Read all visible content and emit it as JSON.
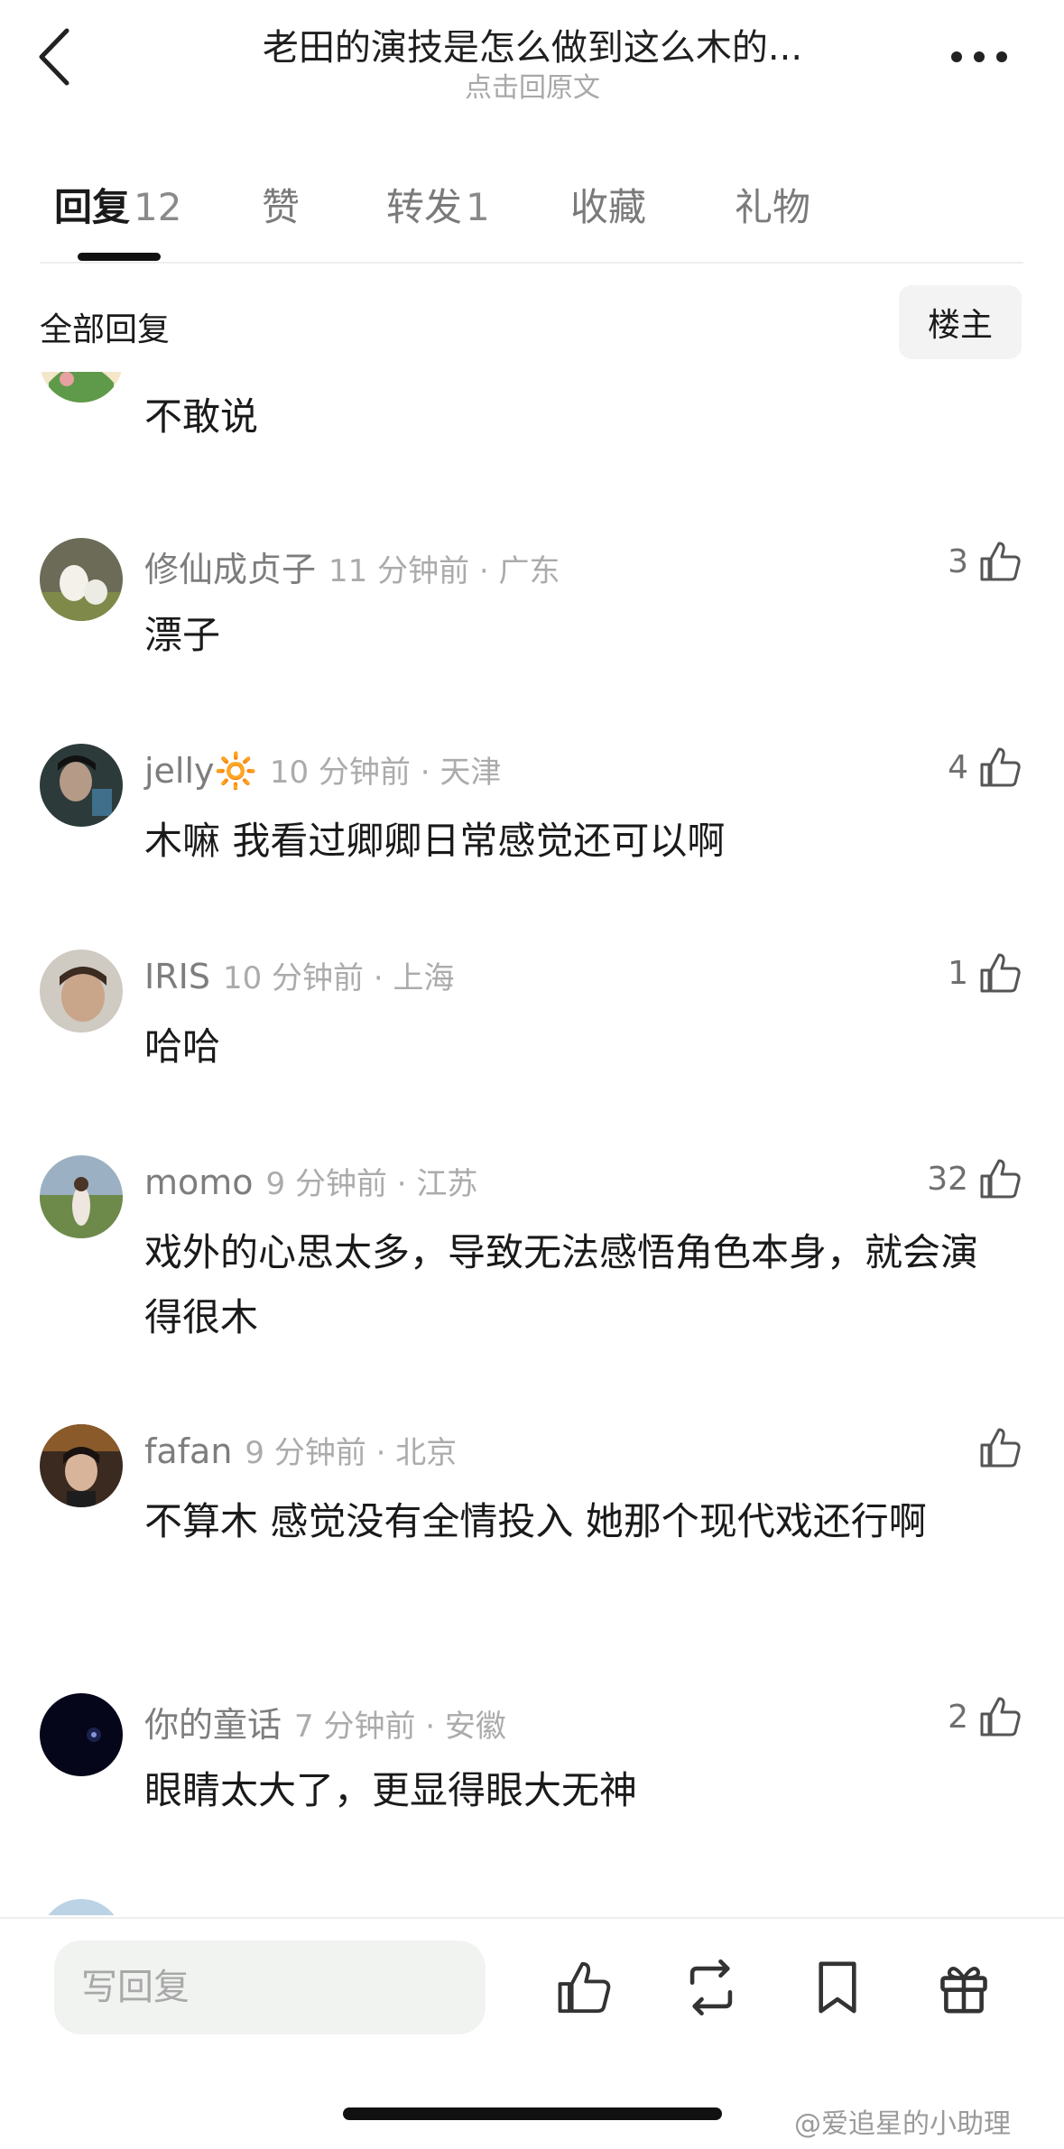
{
  "header": {
    "title": "老田的演技是怎么做到这么木的...",
    "subtitle": "点击回原文"
  },
  "tabs": [
    {
      "label": "回复",
      "count": "12",
      "active": true
    },
    {
      "label": "赞",
      "count": ""
    },
    {
      "label": "转发",
      "count": "1"
    },
    {
      "label": "收藏",
      "count": ""
    },
    {
      "label": "礼物",
      "count": ""
    }
  ],
  "section": {
    "title": "全部回复",
    "owner_button": "楼主"
  },
  "comments": [
    {
      "user": "",
      "meta": "",
      "text": "不敢说",
      "likes": ""
    },
    {
      "user": "修仙成贞子",
      "meta": "11 分钟前 · 广东",
      "text": "漂子",
      "likes": "3"
    },
    {
      "user": "jelly🔆",
      "meta": "10 分钟前 · 天津",
      "text": "木嘛  我看过卿卿日常感觉还可以啊",
      "likes": "4"
    },
    {
      "user": "IRIS",
      "meta": "10 分钟前 · 上海",
      "text": "哈哈",
      "likes": "1"
    },
    {
      "user": "momo",
      "meta": "9 分钟前 · 江苏",
      "text": "戏外的心思太多，导致无法感悟角色本身，就会演得很木",
      "likes": "32"
    },
    {
      "user": "fafan",
      "meta": "9 分钟前 · 北京",
      "text": "不算木 感觉没有全情投入 她那个现代戏还行啊",
      "likes": ""
    },
    {
      "user": "你的童话",
      "meta": "7 分钟前 · 安徽",
      "text": "眼睛太大了，更显得眼大无神",
      "likes": "2"
    }
  ],
  "bottom_bar": {
    "reply_placeholder": "写回复"
  },
  "watermark": "@爱追星的小助理"
}
